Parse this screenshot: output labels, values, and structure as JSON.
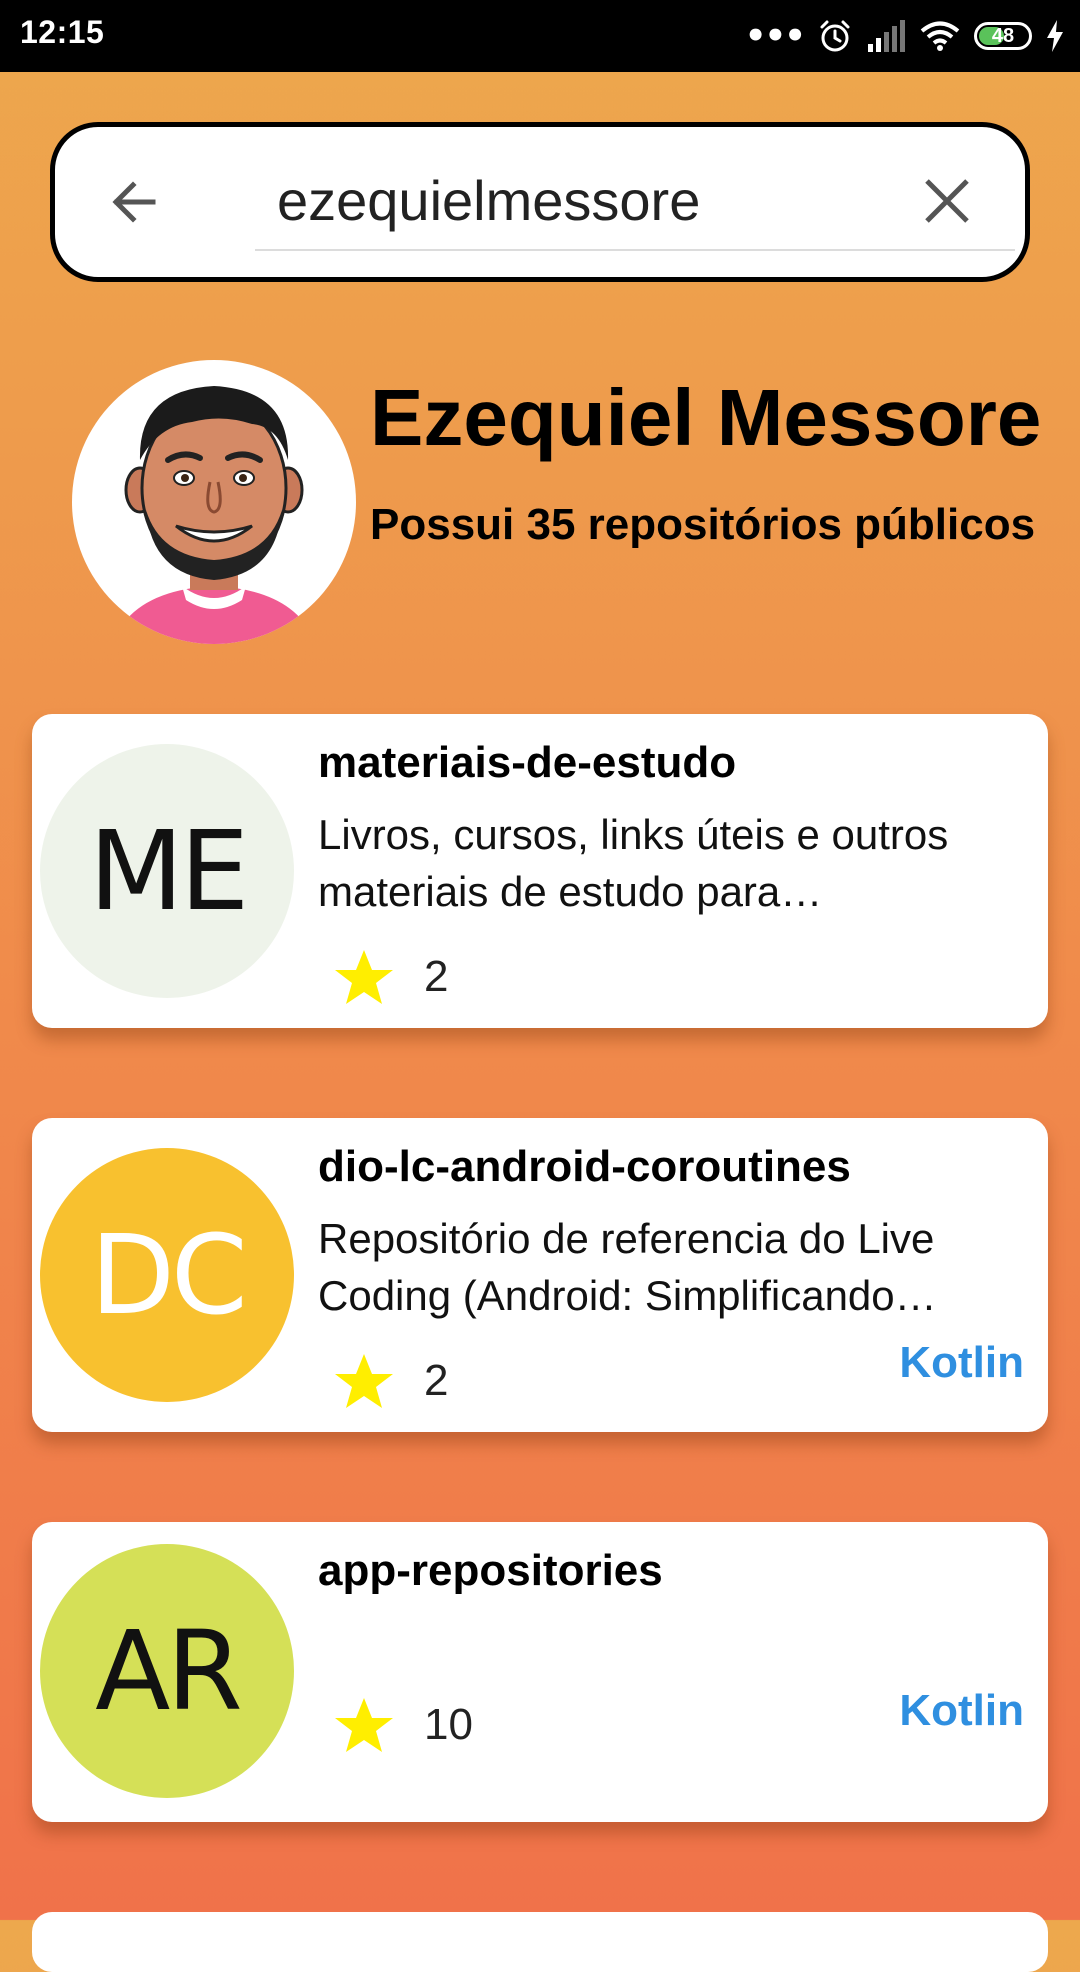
{
  "status_bar": {
    "time": "12:15",
    "dots": "•••",
    "battery_level": "48",
    "icons": [
      "alarm-icon",
      "signal-icon",
      "wifi-icon",
      "battery-icon",
      "charging-icon"
    ]
  },
  "search": {
    "value": "ezequielmessore",
    "back_icon": "arrow-left-icon",
    "clear_icon": "close-icon"
  },
  "profile": {
    "name": "Ezequiel Messore",
    "subtitle": "Possui 35 repositórios públicos"
  },
  "repositories": [
    {
      "initials": "ME",
      "name": "materiais-de-estudo",
      "description": "Livros, cursos, links úteis e outros materiais de estudo para desenvolvedores",
      "stars": "2",
      "language": "",
      "avatar_color": "#eef3ea",
      "initials_color": "#111111"
    },
    {
      "initials": "DC",
      "name": "dio-lc-android-coroutines",
      "description": "Repositório de referencia do Live Coding (Android: Simplificando Coroutines)",
      "stars": "2",
      "language": "Kotlin",
      "avatar_color": "#f8c12f",
      "initials_color": "#ffffff"
    },
    {
      "initials": "AR",
      "name": "app-repositories",
      "description": "",
      "stars": "10",
      "language": "Kotlin",
      "avatar_color": "#d5e057",
      "initials_color": "#111111"
    }
  ],
  "colors": {
    "background_top": "#eda84d",
    "background_bottom": "#f0724a",
    "star": "#ffee00",
    "language": "#2f8fe0"
  }
}
